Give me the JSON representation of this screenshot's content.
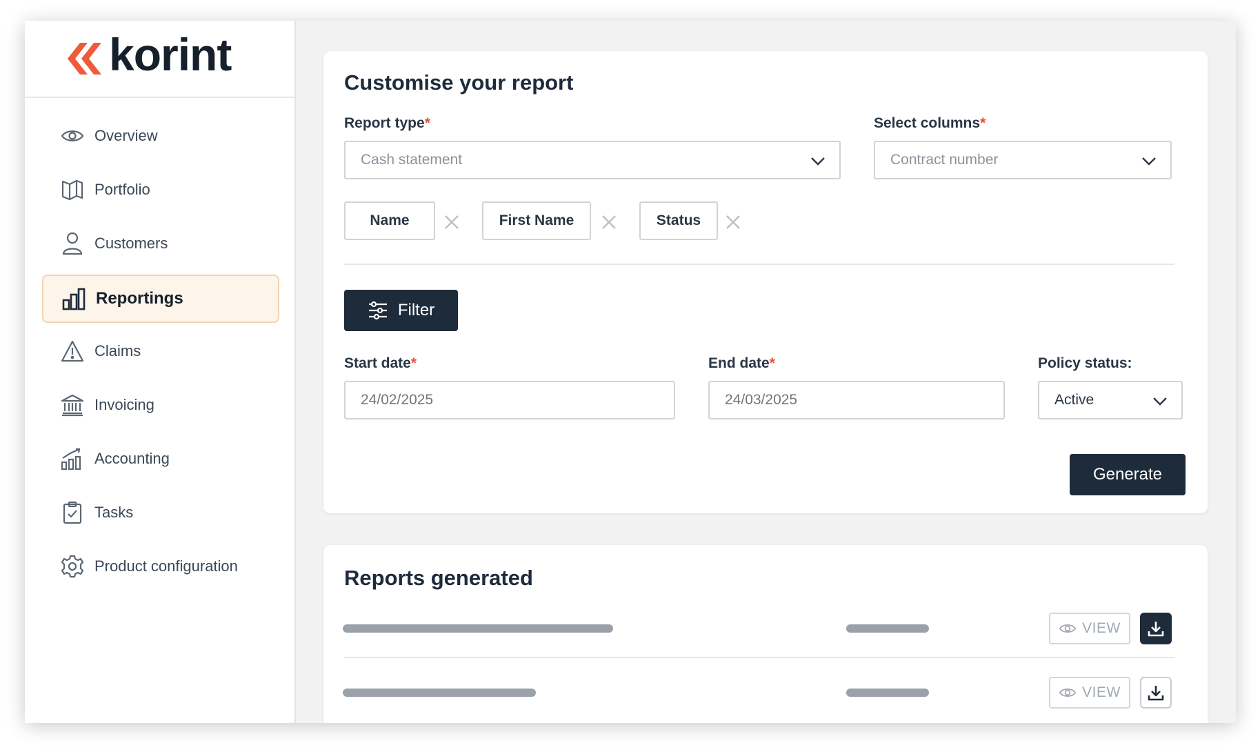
{
  "brand": {
    "name": "korint",
    "accent": "#f05a3c"
  },
  "sidebar": {
    "items": [
      {
        "label": "Overview",
        "icon": "eye-icon"
      },
      {
        "label": "Portfolio",
        "icon": "book-open-icon"
      },
      {
        "label": "Customers",
        "icon": "user-icon"
      },
      {
        "label": "Reportings",
        "icon": "bar-chart-icon",
        "active": true
      },
      {
        "label": "Claims",
        "icon": "warning-icon"
      },
      {
        "label": "Invoicing",
        "icon": "bank-icon"
      },
      {
        "label": "Accounting",
        "icon": "growth-chart-icon"
      },
      {
        "label": "Tasks",
        "icon": "clipboard-check-icon"
      },
      {
        "label": "Product configuration",
        "icon": "gear-icon"
      }
    ]
  },
  "customise": {
    "title": "Customise your report",
    "report_type": {
      "label": "Report type",
      "value": "Cash statement"
    },
    "select_columns": {
      "label": "Select columns",
      "value": "Contract number"
    },
    "required_mark": "*",
    "chips": [
      "Name",
      "First Name",
      "Status"
    ],
    "filter_label": "Filter",
    "start_date": {
      "label": "Start date",
      "placeholder": "24/02/2025"
    },
    "end_date": {
      "label": "End date",
      "placeholder": "24/03/2025"
    },
    "policy_status": {
      "label": "Policy status:",
      "value": "Active"
    },
    "generate_label": "Generate"
  },
  "reports": {
    "title": "Reports generated",
    "view_label": "VIEW"
  }
}
